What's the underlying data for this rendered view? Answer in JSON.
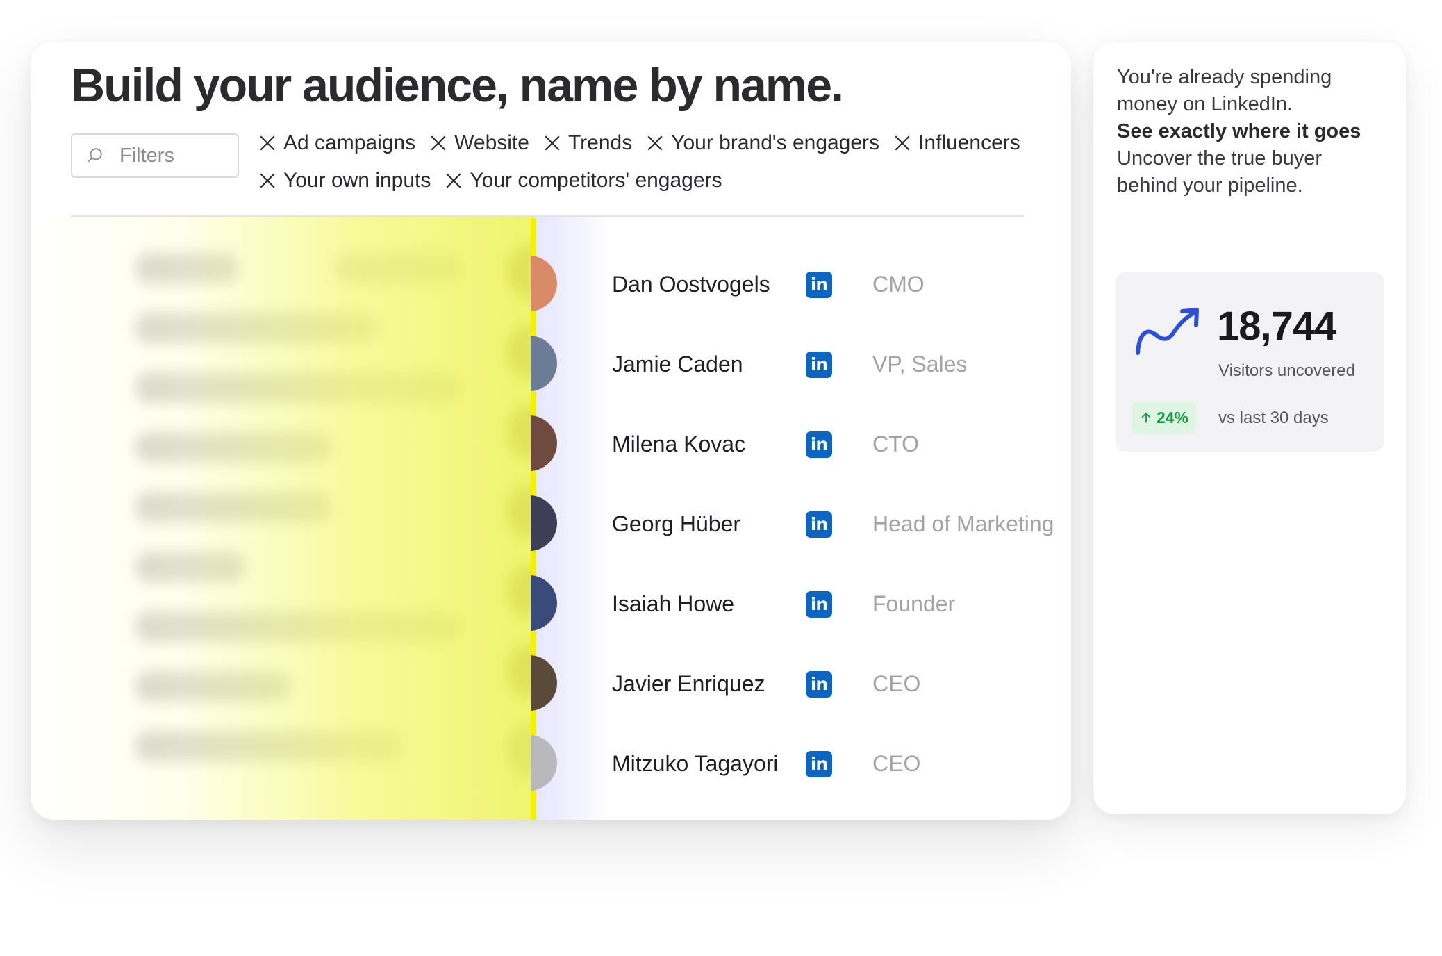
{
  "main": {
    "title": "Build your audience, name by name.",
    "filter": {
      "placeholder": "Filters",
      "icon": "search-icon"
    },
    "chips": [
      {
        "label": "Ad campaigns"
      },
      {
        "label": "Website"
      },
      {
        "label": "Trends"
      },
      {
        "label": "Your brand's engagers"
      },
      {
        "label": "Influencers"
      },
      {
        "label": "Your own inputs"
      },
      {
        "label": "Your competitors' engagers"
      }
    ],
    "people": [
      {
        "name": "Dan Oostvogels",
        "role": "CMO",
        "avatar_color": "#d98a66",
        "linkedin": "in"
      },
      {
        "name": "Jamie Caden",
        "role": "VP, Sales",
        "avatar_color": "#6b7d96",
        "linkedin": "in"
      },
      {
        "name": "Milena Kovac",
        "role": "CTO",
        "avatar_color": "#6e4a3f",
        "linkedin": "in"
      },
      {
        "name": "Georg Hüber",
        "role": "Head of Marketing",
        "avatar_color": "#3c3f55",
        "linkedin": "in"
      },
      {
        "name": "Isaiah Howe",
        "role": "Founder",
        "avatar_color": "#3a4a7a",
        "linkedin": "in"
      },
      {
        "name": "Javier Enriquez",
        "role": "CEO",
        "avatar_color": "#5a4a3a",
        "linkedin": "in"
      },
      {
        "name": "Mitzuko Tagayori",
        "role": "CEO",
        "avatar_color": "#b9b9bc",
        "linkedin": "in"
      }
    ]
  },
  "side": {
    "line1": "You're already spending",
    "line2": "money on LinkedIn.",
    "line3": "See exactly where it goes",
    "line4": "Uncover the true buyer",
    "line5": "behind your pipeline.",
    "stat": {
      "value": "18,744",
      "label": "Visitors uncovered",
      "delta": "24%",
      "delta_label": "vs last 30 days",
      "trend_color": "#2d4fe0",
      "delta_color": "#1b9a3d"
    }
  }
}
